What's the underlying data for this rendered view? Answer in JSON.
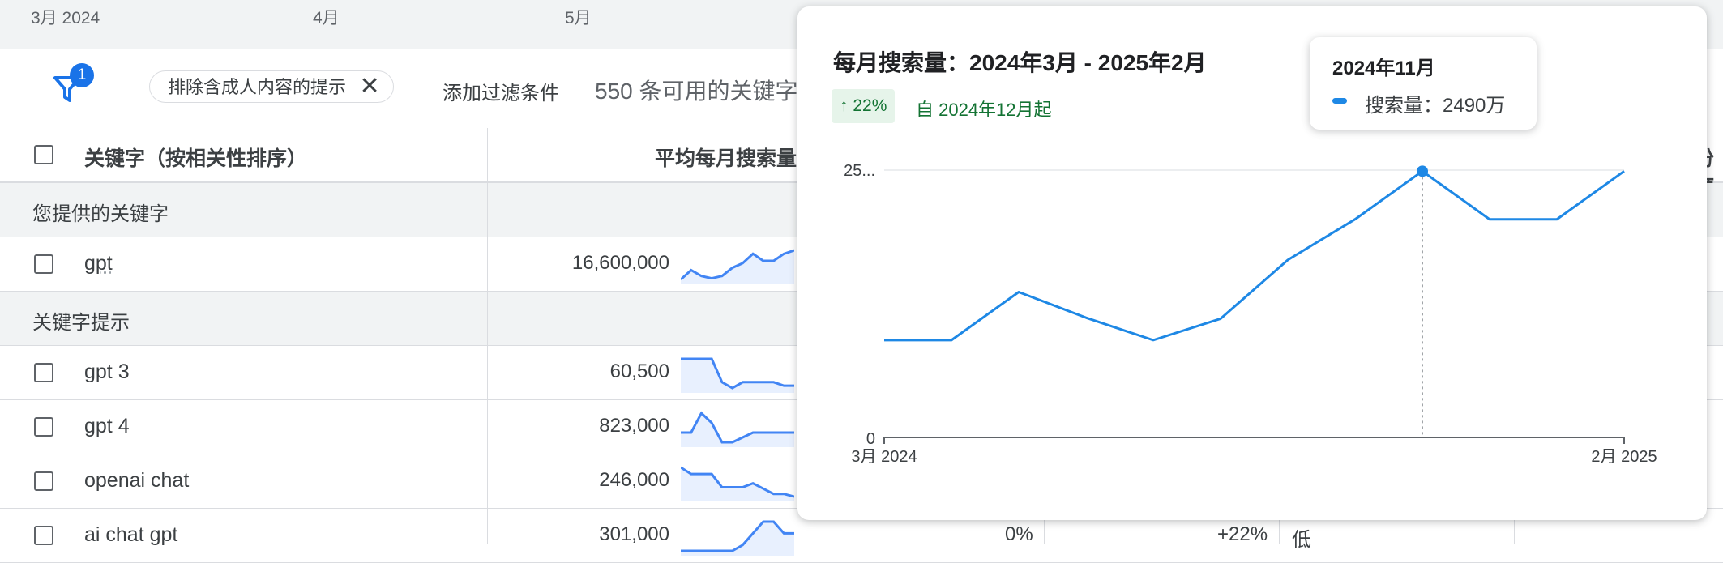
{
  "top_axis": {
    "labels": [
      "3月 2024",
      "4月",
      "5月"
    ]
  },
  "filters": {
    "badge_count": "1",
    "chip_label": "排除含成人内容的提示",
    "chip_close": "✕",
    "add_filter": "添加过滤条件",
    "available_text": "550 条可用的关键字"
  },
  "table": {
    "header_keyword": "关键字（按相关性排序）",
    "header_avg": "平均每月搜索量",
    "header_right_partial": "份额",
    "section_provided": "您提供的关键字",
    "section_suggestions": "关键字提示",
    "provided_rows": [
      {
        "keyword": "gpt",
        "volume": "16,600,000",
        "trend": [
          16.6,
          17.4,
          16.9,
          16.7,
          16.9,
          17.6,
          18.0,
          18.8,
          18.2,
          18.2,
          18.8,
          19.1
        ]
      }
    ],
    "suggestion_rows": [
      {
        "keyword": "gpt 3",
        "volume": "60,500",
        "trend": [
          5,
          5,
          5,
          5,
          3,
          2.5,
          3,
          3,
          3,
          3,
          2.7,
          2.7
        ]
      },
      {
        "keyword": "gpt 4",
        "volume": "823,000",
        "trend": [
          3,
          3,
          5,
          4,
          2,
          2,
          2.5,
          3,
          3,
          3,
          3,
          3
        ]
      },
      {
        "keyword": "openai chat",
        "volume": "246,000",
        "trend": [
          5,
          4.5,
          4.5,
          4.5,
          3.5,
          3.5,
          3.5,
          3.8,
          3.4,
          3,
          3,
          2.8
        ]
      },
      {
        "keyword": "ai chat gpt",
        "volume": "301,000",
        "trend": [
          2,
          2,
          2,
          2,
          2,
          2,
          2.5,
          3.5,
          4.5,
          4.5,
          3.5,
          3.5
        ],
        "change_3m": "0%",
        "change_yoy": "+22%",
        "competition": "低"
      }
    ]
  },
  "popup": {
    "title": "每月搜索量：2024年3月 - 2025年2月",
    "trend_arrow": "↑",
    "trend_pct": "22%",
    "trend_since": "自 2024年12月起",
    "tooltip_title": "2024年11月",
    "tooltip_value": "搜索量：2490万",
    "series_color": "#1e88e5"
  },
  "chart_data": {
    "type": "line",
    "title": "每月搜索量：2024年3月 - 2025年2月",
    "x": [
      "2024-03",
      "2024-04",
      "2024-05",
      "2024-06",
      "2024-07",
      "2024-08",
      "2024-09",
      "2024-10",
      "2024-11",
      "2024-12",
      "2025-01",
      "2025-02"
    ],
    "x_tick_labels": [
      "3月 2024",
      "2月 2025"
    ],
    "y_tick_labels": [
      "0",
      "25..."
    ],
    "series": [
      {
        "name": "搜索量",
        "values": [
          9.1,
          9.1,
          13.6,
          11.2,
          9.1,
          11.1,
          16.6,
          20.4,
          24.9,
          20.4,
          20.4,
          24.9
        ]
      }
    ],
    "ylim": [
      0,
      25
    ],
    "highlight_index": 8,
    "grid": true,
    "legend": "none"
  }
}
